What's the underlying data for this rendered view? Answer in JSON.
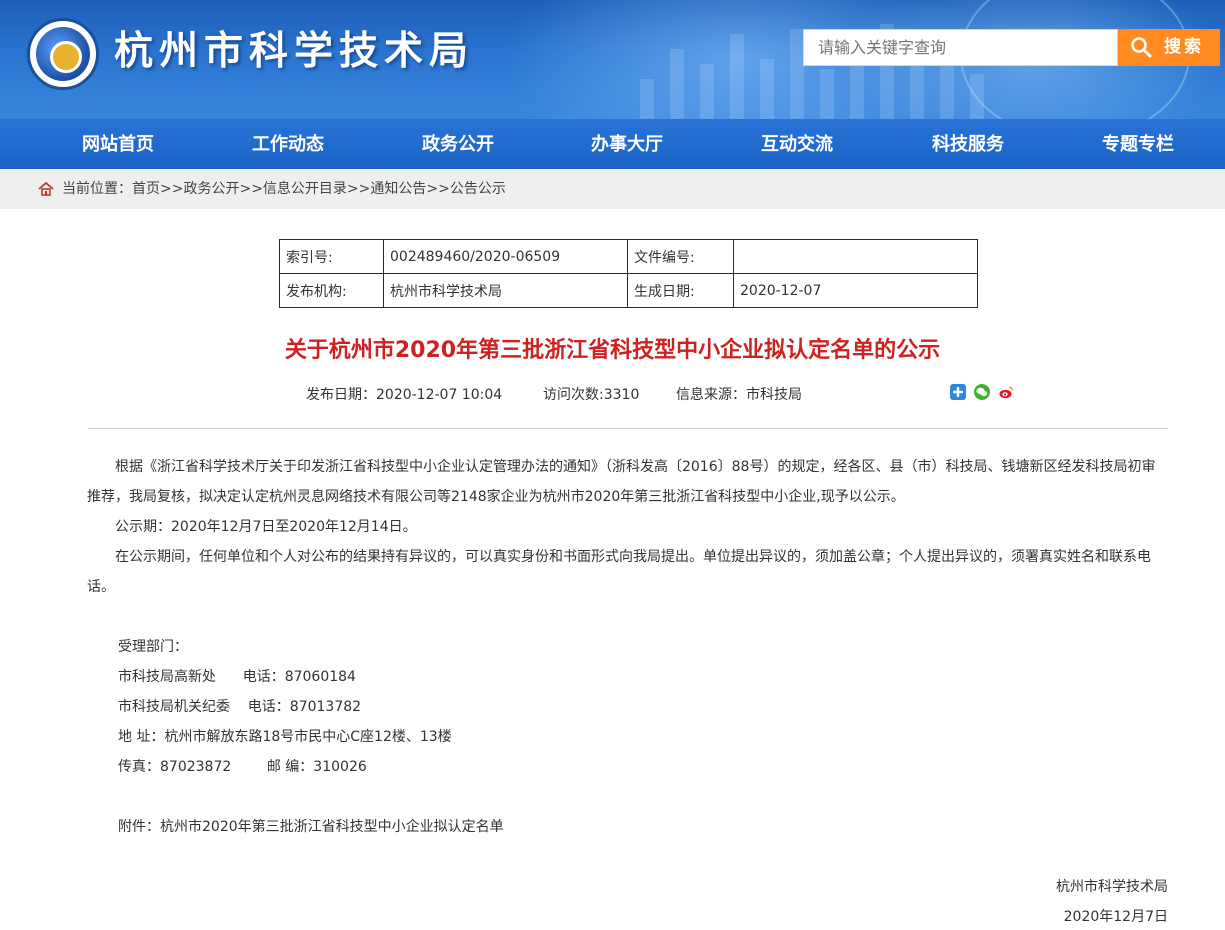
{
  "header": {
    "site_title": "杭州市科学技术局",
    "search_placeholder": "请输入关键字查询",
    "search_button": "搜索"
  },
  "nav": {
    "items": [
      "网站首页",
      "工作动态",
      "政务公开",
      "办事大厅",
      "互动交流",
      "科技服务",
      "专题专栏"
    ]
  },
  "breadcrumb": {
    "text": "当前位置：首页>>政务公开>>信息公开目录>>通知公告>>公告公示"
  },
  "info_table": {
    "index_label": "索引号:",
    "index_value": "002489460/2020-06509",
    "doc_no_label": "文件编号:",
    "doc_no_value": "",
    "publisher_label": "发布机构:",
    "publisher_value": "杭州市科学技术局",
    "created_label": "生成日期:",
    "created_value": "2020-12-07"
  },
  "article": {
    "title": "关于杭州市2020年第三批浙江省科技型中小企业拟认定名单的公示",
    "publish_date": "发布日期：2020-12-07 10:04",
    "visits": "访问次数:3310",
    "source": "信息来源：市科技局",
    "paragraphs": [
      "根据《浙江省科学技术厅关于印发浙江省科技型中小企业认定管理办法的通知》（浙科发高〔2016〕88号）的规定，经各区、县（市）科技局、钱塘新区经发科技局初审推荐，我局复核，拟决定认定杭州灵息网络技术有限公司等2148家企业为杭州市2020年第三批浙江省科技型中小企业,现予以公示。",
      "公示期：2020年12月7日至2020年12月14日。",
      "在公示期间，任何单位和个人对公布的结果持有异议的，可以真实身份和书面形式向我局提出。单位提出异议的，须加盖公章；个人提出异议的，须署真实姓名和联系电话。"
    ],
    "contact_heading": "受理部门：",
    "contact_1": "市科技局高新处      电话：87060184",
    "contact_2": "市科技局机关纪委    电话：87013782",
    "address": "地 址：杭州市解放东路18号市民中心C座12楼、13楼",
    "fax": "传真：87023872        邮 编：310026",
    "attachment": "附件：杭州市2020年第三批浙江省科技型中小企业拟认定名单",
    "sign_org": "杭州市科学技术局",
    "sign_date": "2020年12月7日"
  },
  "colors": {
    "banner_blue": "#2a74d0",
    "nav_blue": "#1a63c7",
    "search_orange": "#ff8a1f",
    "title_red": "#cc2222"
  },
  "icons": [
    "logo-emblem",
    "search-icon",
    "home-icon",
    "share-plus-icon",
    "wechat-icon",
    "weibo-icon"
  ]
}
